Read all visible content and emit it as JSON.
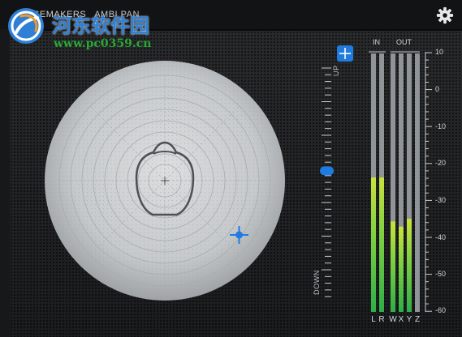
{
  "app": {
    "brand_left": "NOISEMAKERS",
    "brand_right": "AMBI PAN"
  },
  "watermark": {
    "title": "河东软件园",
    "url": "www.pc0359.cn"
  },
  "toolbar": {
    "settings_icon": "gear-icon"
  },
  "panner": {
    "head_icon": "head-outline-icon",
    "source_icon": "blue-crosshair-icon",
    "source_color": "#1f7be0"
  },
  "elevation": {
    "up_label": "UP",
    "down_label": "DOWN",
    "reset_icon": "plus-square-icon",
    "value": 0.45
  },
  "meters": {
    "in_label": "IN",
    "out_label": "OUT",
    "scale": [
      "10",
      "0",
      "-10",
      "-20",
      "-30",
      "-40",
      "-50",
      "-60"
    ],
    "channels": [
      {
        "name": "L",
        "level": 0.52
      },
      {
        "name": "R",
        "level": 0.52
      },
      {
        "name": "W",
        "level": 0.35
      },
      {
        "name": "X",
        "level": 0.33
      },
      {
        "name": "Y",
        "level": 0.36
      },
      {
        "name": "Z",
        "level": 0.0
      }
    ],
    "colors": {
      "top": "#c9e23c",
      "bottom": "#2fae47",
      "background": "#8f9499"
    }
  }
}
